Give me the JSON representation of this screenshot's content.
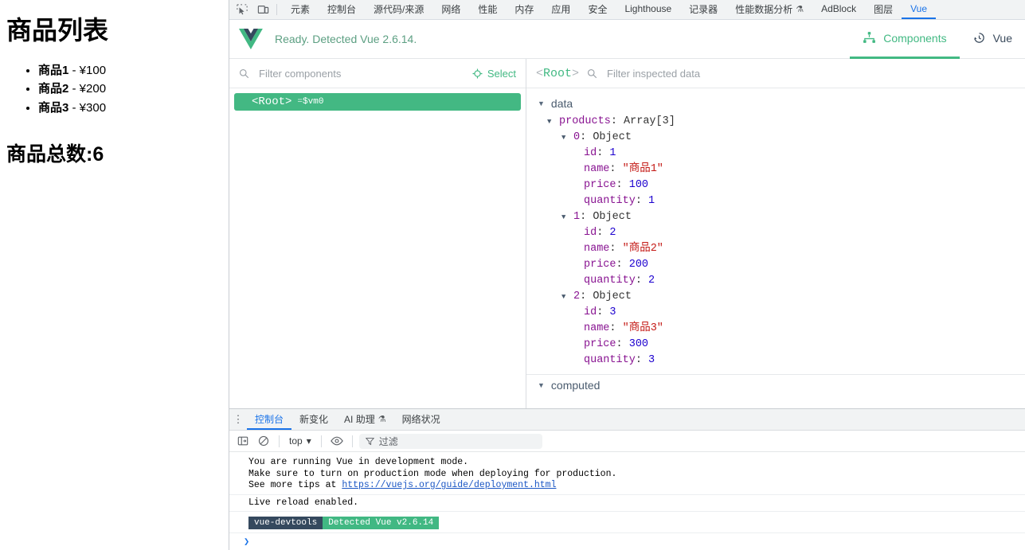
{
  "page": {
    "title": "商品列表",
    "products": [
      {
        "name": "商品1",
        "rest": " - ¥100"
      },
      {
        "name": "商品2",
        "rest": " - ¥200"
      },
      {
        "name": "商品3",
        "rest": " - ¥300"
      }
    ],
    "total_label": "商品总数:6"
  },
  "devtools": {
    "icons": {
      "inspect": "inspect-element-icon",
      "device": "device-toolbar-icon"
    },
    "tabs": [
      {
        "label": "元素",
        "active": false
      },
      {
        "label": "控制台",
        "active": false
      },
      {
        "label": "源代码/来源",
        "active": false
      },
      {
        "label": "网络",
        "active": false
      },
      {
        "label": "性能",
        "active": false
      },
      {
        "label": "内存",
        "active": false
      },
      {
        "label": "应用",
        "active": false
      },
      {
        "label": "安全",
        "active": false
      },
      {
        "label": "Lighthouse",
        "active": false
      },
      {
        "label": "记录器",
        "active": false
      },
      {
        "label": "性能数据分析",
        "active": false,
        "flask": "⚗"
      },
      {
        "label": "AdBlock",
        "active": false
      },
      {
        "label": "图层",
        "active": false
      },
      {
        "label": "Vue",
        "active": true
      }
    ]
  },
  "vue": {
    "status": "Ready. Detected Vue 2.6.14.",
    "panels": [
      {
        "label": "Components",
        "icon": "components-tree-icon",
        "active": true
      },
      {
        "label": "Vue",
        "icon": "history-clock-icon",
        "active": false
      }
    ],
    "tree_toolbar": {
      "filter_placeholder": "Filter components",
      "filter_value": "",
      "search_icon": "search-icon",
      "select_label": "Select",
      "select_icon": "target-crosshair-icon"
    },
    "tree": [
      {
        "tag": "<Root>",
        "eq": "=",
        "vm": "$vm0",
        "selected": true
      }
    ],
    "inspector_toolbar": {
      "crumb_open": "<",
      "crumb_name": "Root",
      "crumb_close": ">",
      "search_icon": "search-icon",
      "filter_placeholder": "Filter inspected data",
      "filter_value": ""
    },
    "groups": [
      {
        "name": "data",
        "expanded": true
      },
      {
        "name": "computed",
        "expanded": true
      }
    ],
    "data_tree": {
      "root_key": "products",
      "root_type": "Array[3]",
      "items": [
        {
          "index": "0",
          "type": "Object",
          "fields": [
            {
              "key": "id",
              "value": "1",
              "kind": "num"
            },
            {
              "key": "name",
              "value": "\"商品1\"",
              "kind": "str"
            },
            {
              "key": "price",
              "value": "100",
              "kind": "num"
            },
            {
              "key": "quantity",
              "value": "1",
              "kind": "num"
            }
          ]
        },
        {
          "index": "1",
          "type": "Object",
          "fields": [
            {
              "key": "id",
              "value": "2",
              "kind": "num"
            },
            {
              "key": "name",
              "value": "\"商品2\"",
              "kind": "str"
            },
            {
              "key": "price",
              "value": "200",
              "kind": "num"
            },
            {
              "key": "quantity",
              "value": "2",
              "kind": "num"
            }
          ]
        },
        {
          "index": "2",
          "type": "Object",
          "fields": [
            {
              "key": "id",
              "value": "3",
              "kind": "num"
            },
            {
              "key": "name",
              "value": "\"商品3\"",
              "kind": "str"
            },
            {
              "key": "price",
              "value": "300",
              "kind": "num"
            },
            {
              "key": "quantity",
              "value": "3",
              "kind": "num"
            }
          ]
        }
      ]
    }
  },
  "drawer": {
    "kebab": "⋮",
    "tabs": [
      {
        "label": "控制台",
        "active": true
      },
      {
        "label": "新变化",
        "active": false
      },
      {
        "label": "AI 助理",
        "active": false,
        "flask": "⚗"
      },
      {
        "label": "网络状况",
        "active": false
      }
    ],
    "toolbar": {
      "sidebar_icon": "show-console-sidebar-icon",
      "clear_icon": "clear-console-icon",
      "context": "top",
      "context_caret": "▾",
      "eye_icon": "live-expression-icon",
      "filter_icon": "filter-icon",
      "filter_placeholder": "过滤",
      "filter_value": ""
    },
    "console": {
      "messages": [
        "You are running Vue in development mode.",
        "Make sure to turn on production mode when deploying for production."
      ],
      "tip_prefix": "See more tips at ",
      "tip_link": "https://vuejs.org/guide/deployment.html",
      "live_reload": "Live reload enabled.",
      "badge_label": "vue-devtools",
      "badge_value": "Detected Vue v2.6.14",
      "prompt": "❯"
    }
  },
  "colors": {
    "vue_green": "#42b983",
    "vue_dark": "#35495e",
    "chrome_blue": "#1a73e8",
    "key_purple": "#881391",
    "number_blue": "#1c00cf",
    "string_red": "#c41a16"
  }
}
